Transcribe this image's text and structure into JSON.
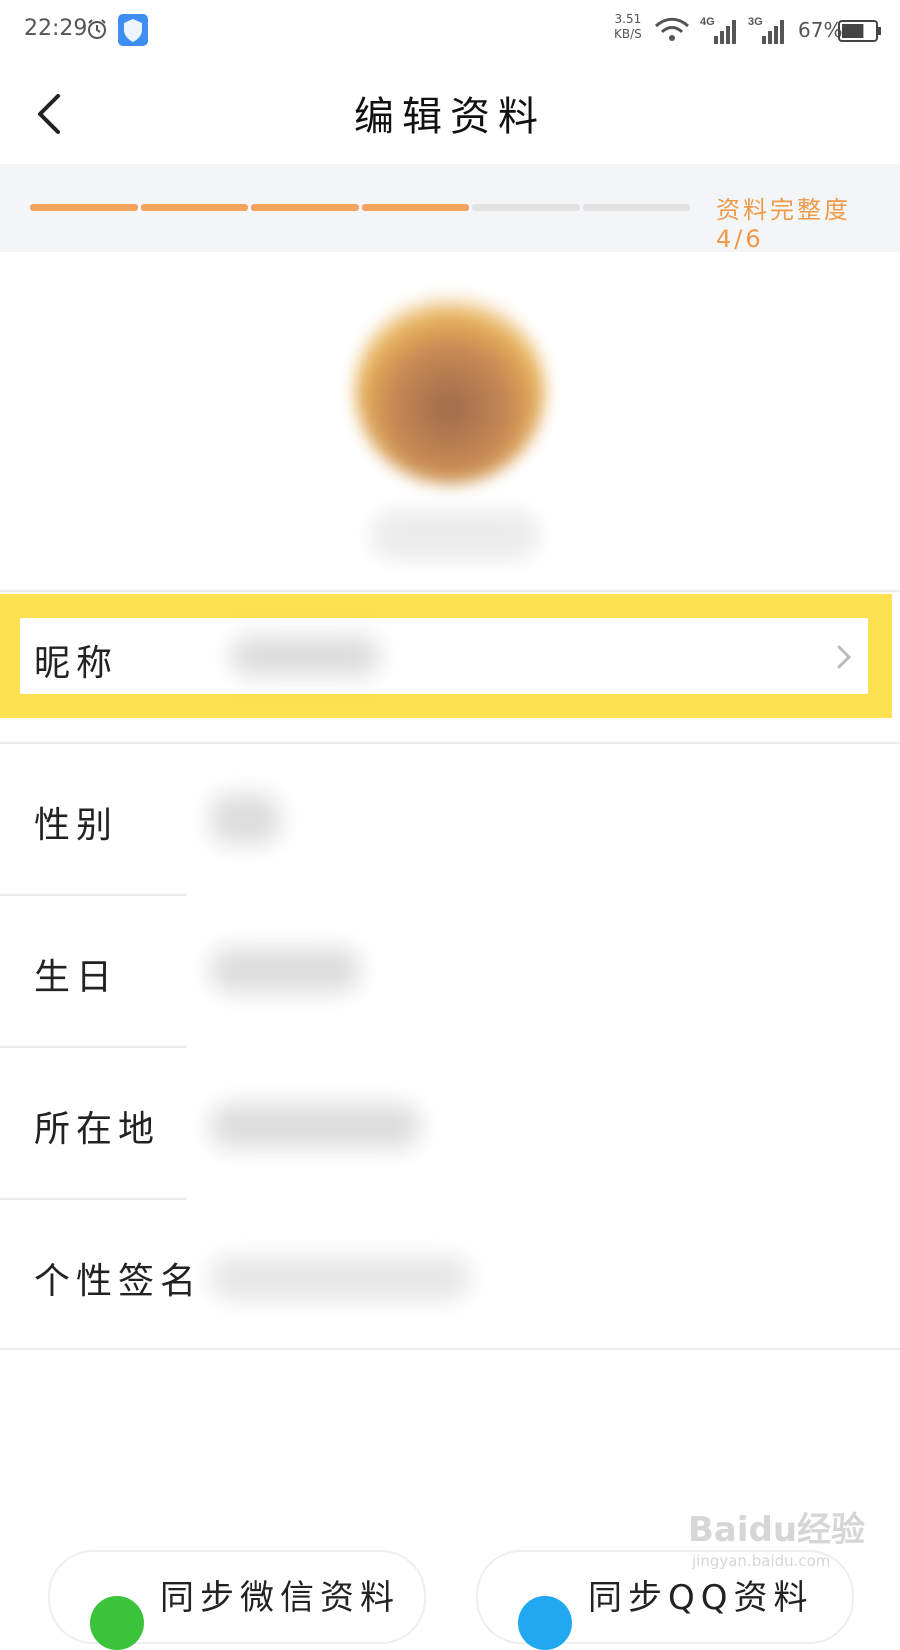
{
  "status_bar": {
    "time": "22:29",
    "net_speed_value": "3.51",
    "net_speed_unit": "KB/S",
    "signal1_label": "4G",
    "signal2_label": "3G",
    "battery_percent": "67%",
    "battery_level": 0.67
  },
  "header": {
    "title": "编辑资料",
    "back_icon": "chevron-left-icon"
  },
  "profile_completeness": {
    "label": "资料完整度 4/6",
    "completed": 4,
    "total": 6,
    "color_done": "#f2a35e",
    "color_todo": "#e2e2e2"
  },
  "fields": [
    {
      "label": "昵称",
      "highlighted": true
    },
    {
      "label": "性别"
    },
    {
      "label": "生日"
    },
    {
      "label": "所在地"
    },
    {
      "label": "个性签名"
    }
  ],
  "sync_buttons": [
    {
      "label": "同步微信资料",
      "icon": "wechat-icon",
      "color": "#3bc43b"
    },
    {
      "label": "同步QQ资料",
      "icon": "qq-icon",
      "color": "#20a8f0"
    }
  ],
  "watermark": {
    "brand": "Baidu经验",
    "url": "jingyan.baidu.com"
  },
  "colors": {
    "highlight": "#fde150",
    "accent": "#ef9a4a"
  }
}
